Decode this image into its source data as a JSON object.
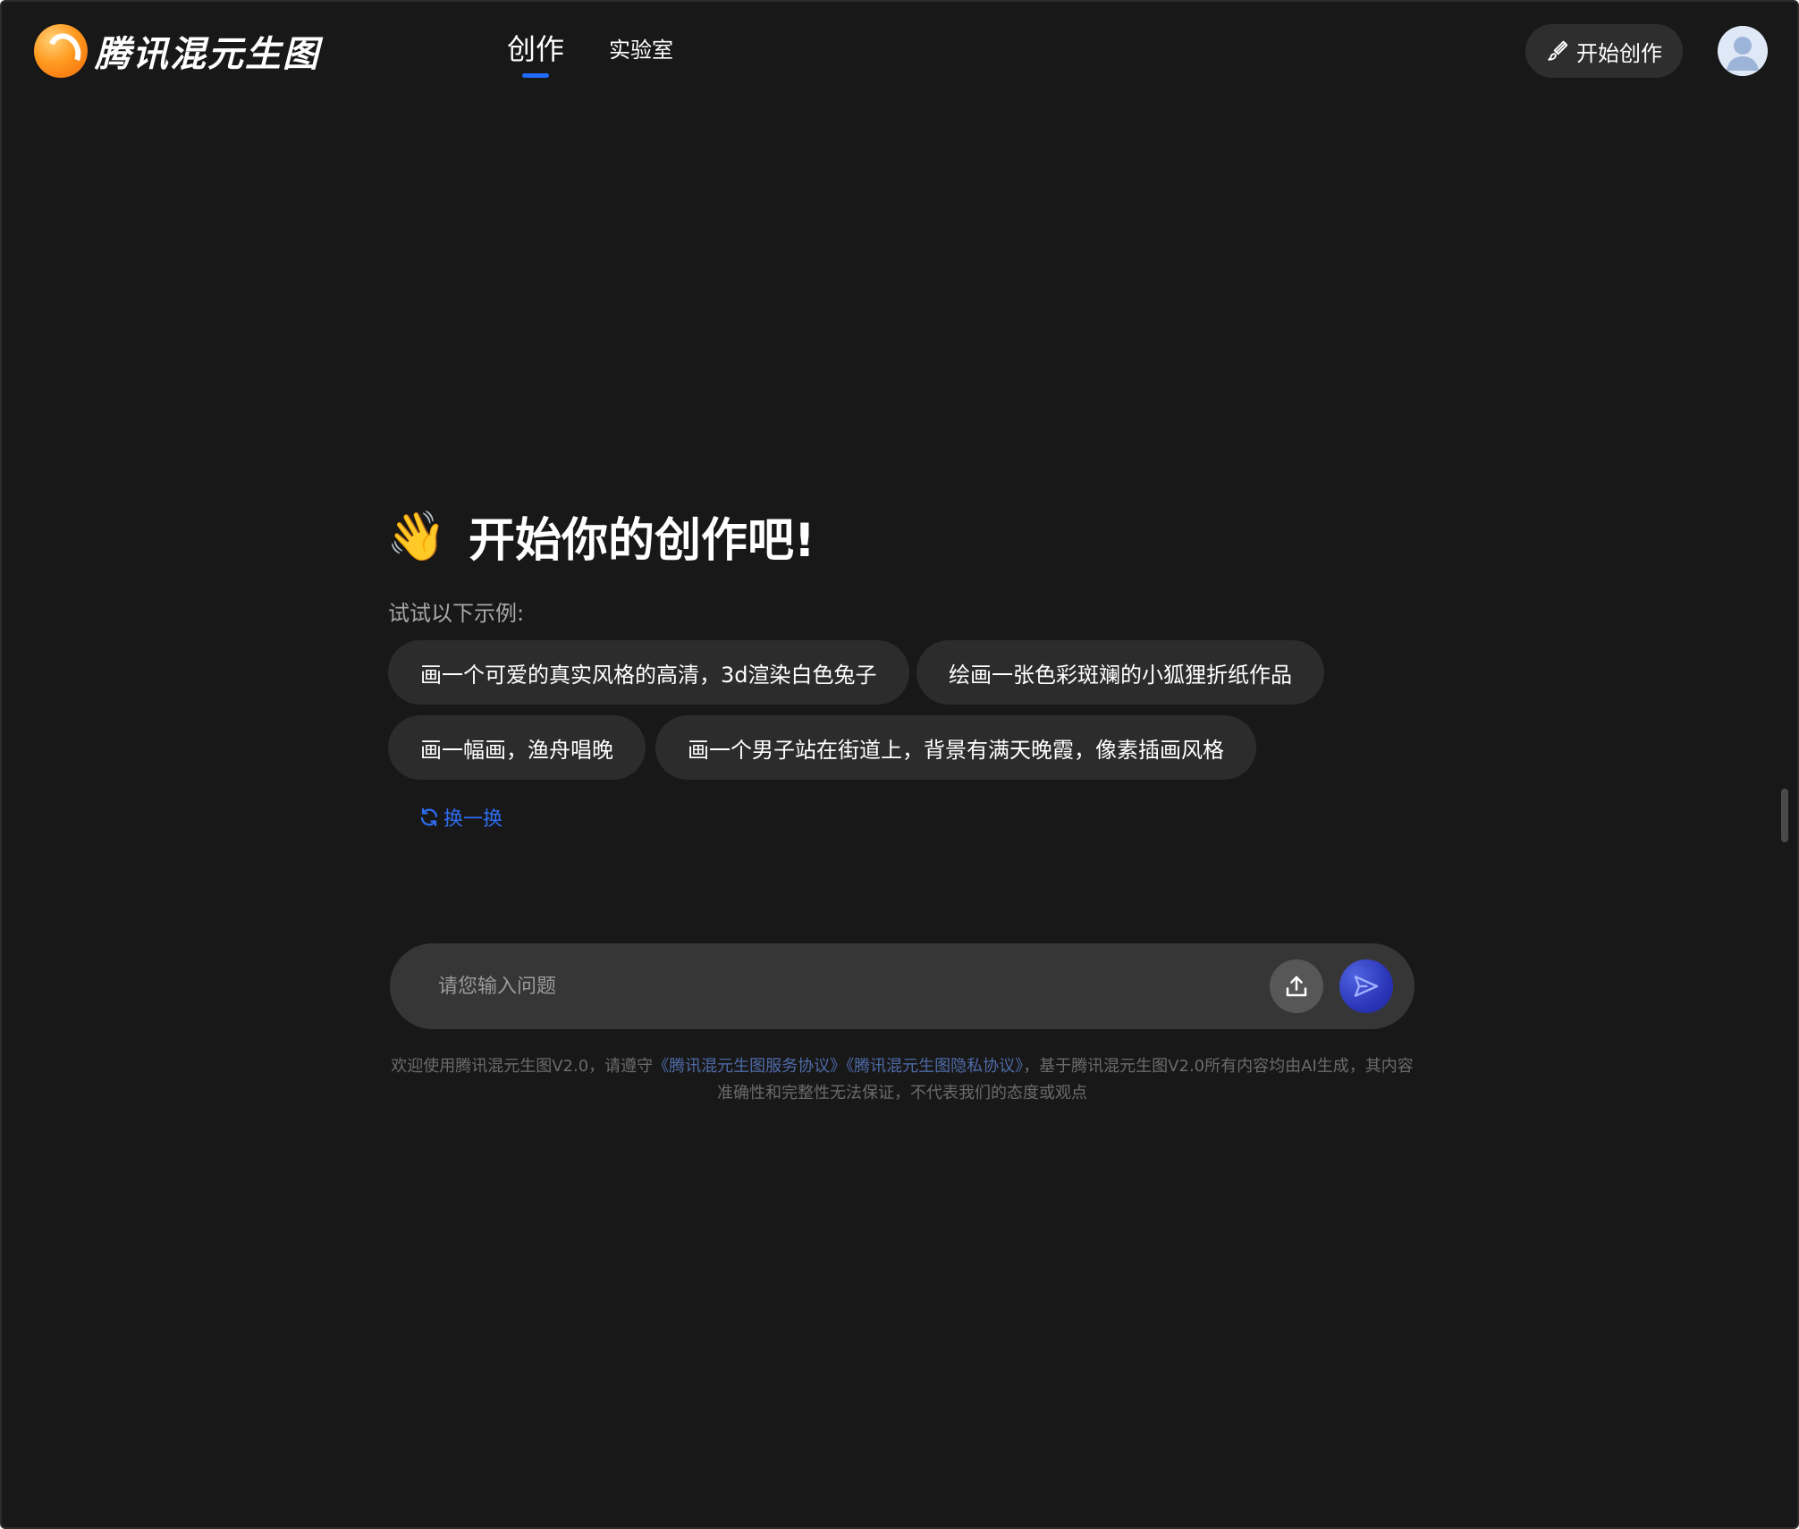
{
  "header": {
    "logo_text": "腾讯混元生图",
    "nav": [
      {
        "label": "创作"
      },
      {
        "label": "实验室"
      }
    ],
    "start_button_label": "开始创作"
  },
  "hero": {
    "emoji": "👋",
    "title": "开始你的创作吧!",
    "subtitle": "试试以下示例:"
  },
  "examples": [
    "画一个可爱的真实风格的高清，3d渲染白色兔子",
    "绘画一张色彩斑斓的小狐狸折纸作品",
    "画一幅画，渔舟唱晚",
    "画一个男子站在街道上，背景有满天晚霞，像素插画风格"
  ],
  "refresh_label": "换一换",
  "input": {
    "placeholder": "请您输入问题",
    "value": ""
  },
  "disclaimer": {
    "prefix": "欢迎使用腾讯混元生图V2.0，请遵守",
    "link_service": "《腾讯混元生图服务协议》",
    "link_privacy": "《腾讯混元生图隐私协议》",
    "suffix": "，基于腾讯混元生图V2.0所有内容均由AI生成，其内容准确性和完整性无法保证，不代表我们的态度或观点"
  },
  "colors": {
    "background": "#181818",
    "accent": "#1f6bff",
    "chip": "#2c2c2c",
    "input": "#363636"
  }
}
